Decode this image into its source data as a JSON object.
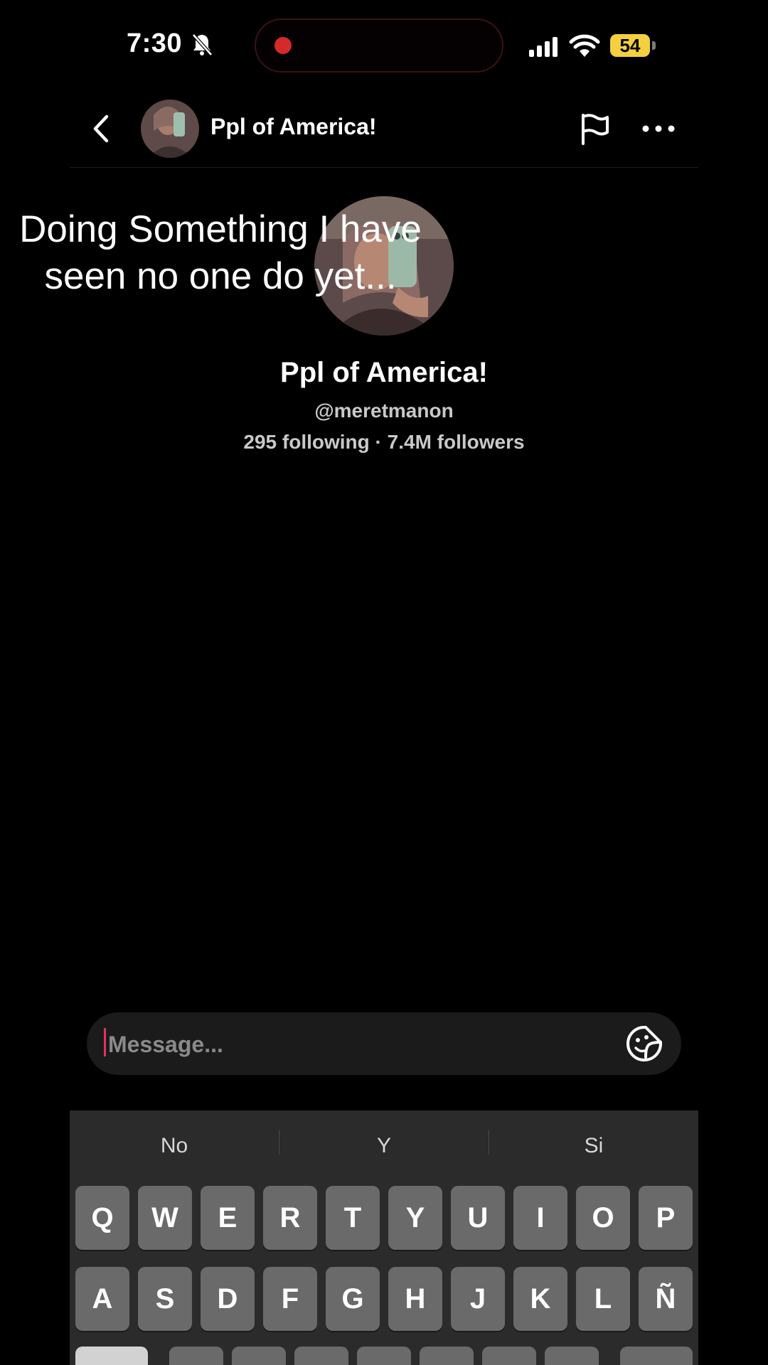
{
  "status_bar": {
    "time": "7:30",
    "battery_level": "54",
    "icons": [
      "bell-slash-icon",
      "signal-icon",
      "wifi-icon",
      "battery-icon"
    ],
    "recording_color": "#d42a2a",
    "battery_color": "#f4d03f"
  },
  "header": {
    "title": "Ppl of America!",
    "icons": [
      "back-chevron-icon",
      "flag-icon",
      "more-icon"
    ]
  },
  "overlay_caption": {
    "line1": "Doing Something I have",
    "line2": "seen no one do yet..."
  },
  "profile": {
    "name": "Ppl of America!",
    "handle": "@meretmanon",
    "stats": "295 following · 7.4M followers"
  },
  "message_bar": {
    "placeholder": "Message...",
    "value": "",
    "icons": [
      "sticker-icon"
    ],
    "caret_color": "#e8305c"
  },
  "keyboard": {
    "suggestions": [
      "No",
      "Y",
      "Si"
    ],
    "row1": [
      "Q",
      "W",
      "E",
      "R",
      "T",
      "Y",
      "U",
      "I",
      "O",
      "P"
    ],
    "row2": [
      "A",
      "S",
      "D",
      "F",
      "G",
      "H",
      "J",
      "K",
      "L",
      "Ñ"
    ]
  }
}
